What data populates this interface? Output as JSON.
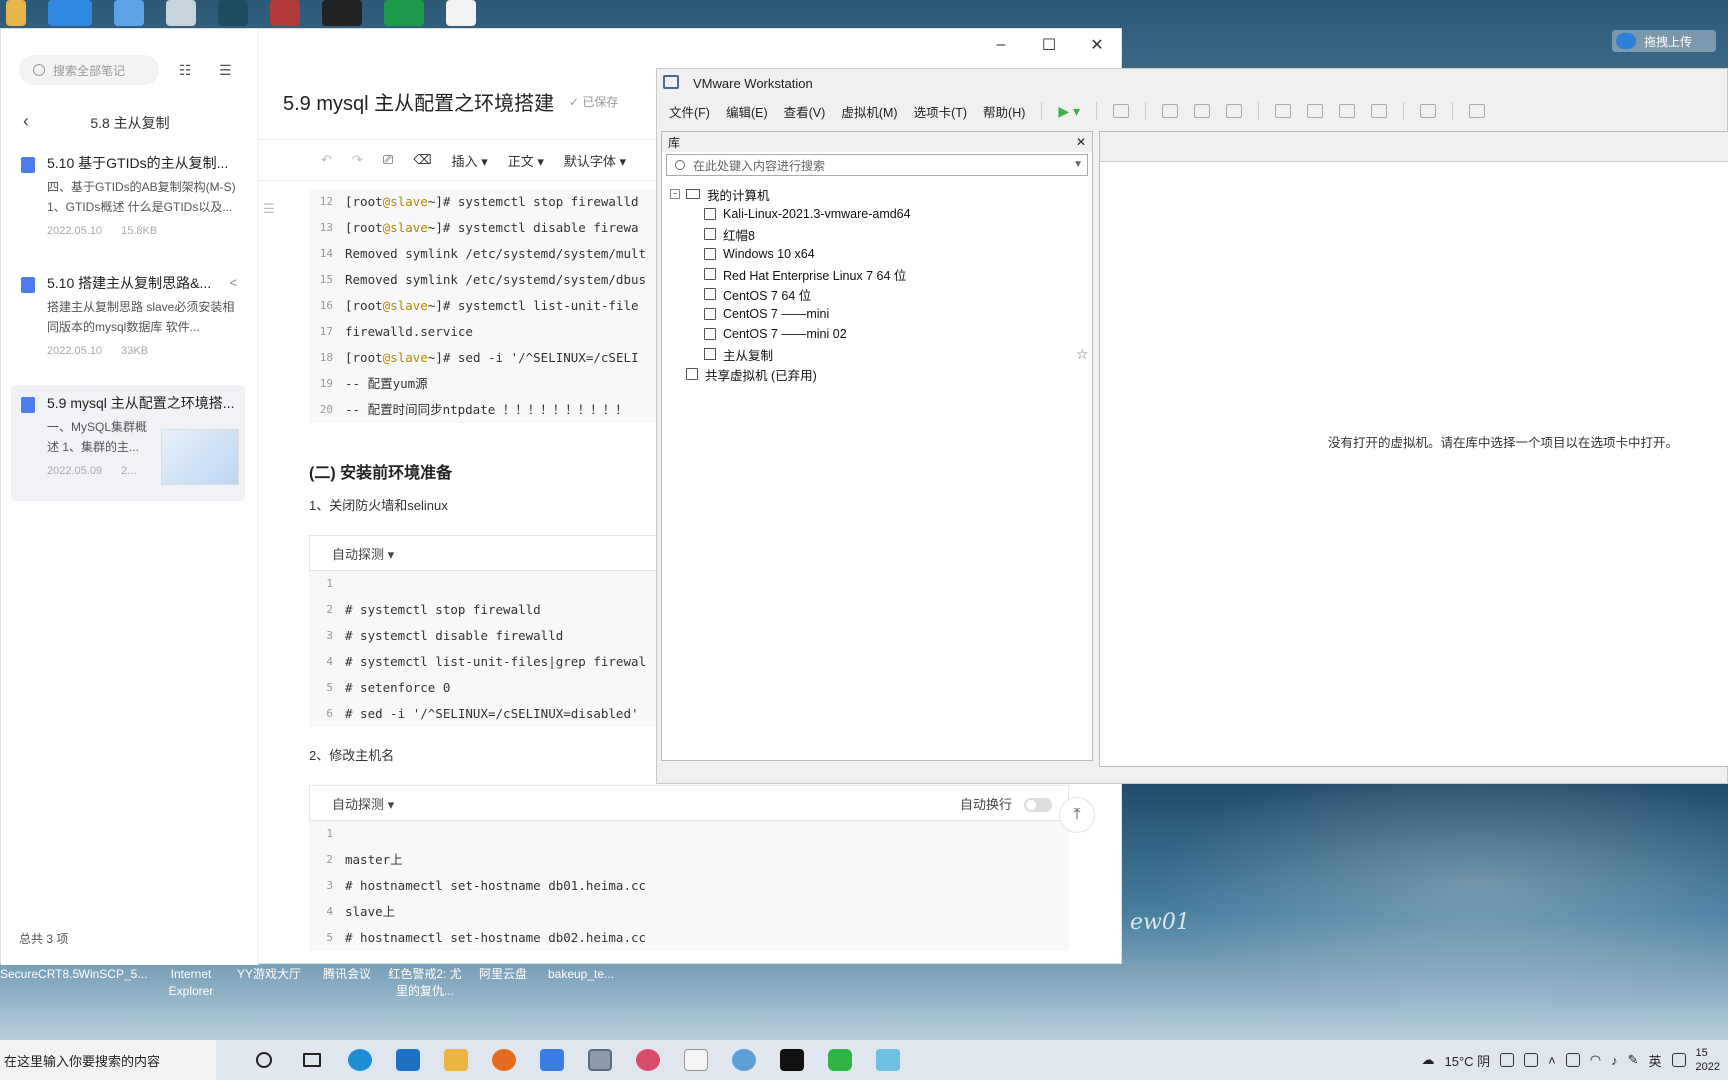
{
  "notes_app": {
    "search_placeholder": "搜索全部笔记",
    "folder_title": "5.8 主从复制",
    "notes": [
      {
        "title": "5.10 基于GTIDs的主从复制...",
        "snippet": "四、基于GTIDs的AB复制架构(M-S) 1、GTIDs概述 什么是GTIDs以及...",
        "date": "2022.05.10",
        "size": "15.8KB"
      },
      {
        "title": "5.10 搭建主从复制思路&...",
        "snippet": "搭建主从复制思路 slave必须安装相同版本的mysql数据库 软件...",
        "date": "2022.05.10",
        "size": "33KB"
      },
      {
        "title": "5.9 mysql 主从配置之环境搭...",
        "snippet": "一、MySQL集群概述 1、集群的主...",
        "date": "2022.05.09",
        "size": "2..."
      }
    ],
    "footer": "总共 3 项",
    "doc_title": "5.9 mysql 主从配置之环境搭建",
    "saved_label": "已保存",
    "toolbar": {
      "insert": "插入",
      "body": "正文",
      "font": "默认字体"
    },
    "code_block_1": [
      {
        "n": "12",
        "pre": "[root",
        "at": "@slave",
        "post": " ~]# systemctl stop firewalld"
      },
      {
        "n": "13",
        "pre": "[root",
        "at": "@slave",
        "post": " ~]# systemctl disable firewa"
      },
      {
        "n": "14",
        "pre": "Removed symlink /etc/systemd/system/mult",
        "at": "",
        "post": ""
      },
      {
        "n": "15",
        "pre": "Removed symlink /etc/systemd/system/dbus",
        "at": "",
        "post": ""
      },
      {
        "n": "16",
        "pre": "[root",
        "at": "@slave",
        "post": " ~]# systemctl list-unit-file"
      },
      {
        "n": "17",
        "pre": "firewalld.service",
        "at": "",
        "post": ""
      },
      {
        "n": "18",
        "pre": "[root",
        "at": "@slave",
        "post": " ~]# sed -i '/^SELINUX=/cSELI"
      },
      {
        "n": "19",
        "pre": "-- 配置yum源",
        "at": "",
        "post": ""
      },
      {
        "n": "20",
        "pre": "-- 配置时间同步ntpdate ！！！！！！！！！！",
        "at": "",
        "post": ""
      }
    ],
    "heading_2": "(二) 安装前环境准备",
    "para_1": "1、关闭防火墙和selinux",
    "code_lang": "自动探测",
    "code_block_2": [
      {
        "n": "1",
        "text": ""
      },
      {
        "n": "2",
        "text": "# systemctl stop firewalld"
      },
      {
        "n": "3",
        "text": "# systemctl disable firewalld"
      },
      {
        "n": "4",
        "text": "# systemctl list-unit-files|grep firewal"
      },
      {
        "n": "5",
        "text": "# setenforce 0"
      },
      {
        "n": "6",
        "text": "# sed -i '/^SELINUX=/cSELINUX=disabled'"
      }
    ],
    "para_2": "2、修改主机名",
    "wrap_label": "自动换行",
    "code_block_3": [
      {
        "n": "1",
        "text": ""
      },
      {
        "n": "2",
        "text": "master上"
      },
      {
        "n": "3",
        "text": "# hostnamectl set-hostname db01.heima.cc"
      },
      {
        "n": "4",
        "text": "slave上"
      },
      {
        "n": "5",
        "text": "# hostnamectl set-hostname db02.heima.cc"
      }
    ]
  },
  "vmware": {
    "title": "VMware Workstation",
    "menu": [
      "文件(F)",
      "编辑(E)",
      "查看(V)",
      "虚拟机(M)",
      "选项卡(T)",
      "帮助(H)"
    ],
    "library_label": "库",
    "search_placeholder": "在此处键入内容进行搜索",
    "my_computer": "我的计算机",
    "vms": [
      "Kali-Linux-2021.3-vmware-amd64",
      "红帽8",
      "Windows 10 x64",
      "Red Hat Enterprise Linux 7 64 位",
      "CentOS 7 64 位",
      "CentOS 7 ——mini",
      "CentOS 7 ——mini 02",
      "主从复制"
    ],
    "shared": "共享虚拟机 (已弃用)",
    "empty_message": "没有打开的虚拟机。请在库中选择一个项目以在选项卡中打开。"
  },
  "desktop": {
    "upload_label": "拖拽上传",
    "labels": [
      "SecureCRT8.5",
      "WinSCP_5...",
      "Internet Explorer",
      "YY游戏大厅",
      "腾讯会议",
      "红色警戒2: 尤里的复仇...",
      "阿里云盘",
      "bakeup_te..."
    ],
    "signature": "ew01"
  },
  "taskbar": {
    "search_text": "在这里输入你要搜索的内容",
    "weather": "15°C 阴",
    "ime": "英",
    "clock_time": "15",
    "clock_date": "2022"
  }
}
